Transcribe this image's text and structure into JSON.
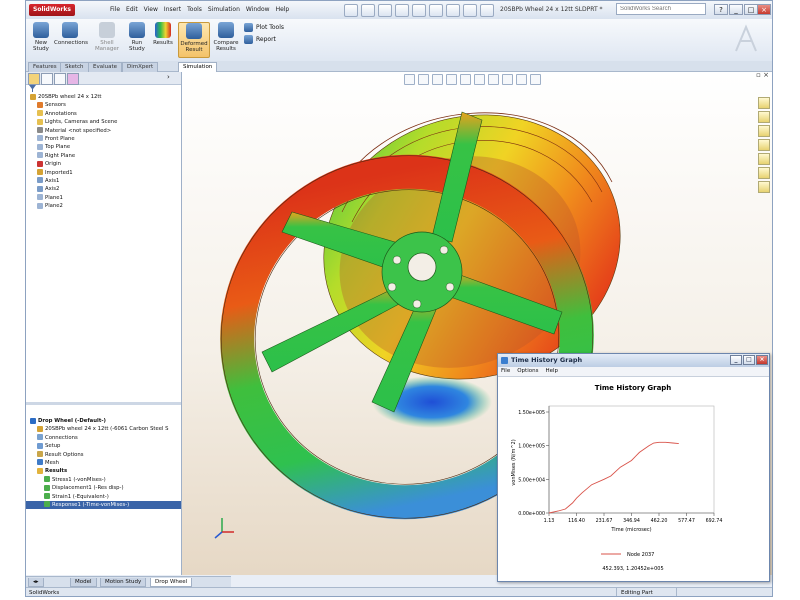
{
  "app": {
    "logo": "SolidWorks",
    "menu": [
      "File",
      "Edit",
      "View",
      "Insert",
      "Tools",
      "Simulation",
      "Window",
      "Help"
    ],
    "document_title": "20SBPb Wheel 24 x 12tt SLDPRT *",
    "search_placeholder": "SolidWorks Search",
    "window_buttons": [
      "?",
      "_",
      "□",
      "×"
    ]
  },
  "ribbon": {
    "buttons": [
      {
        "label": "New Study",
        "icon": "new-study-icon"
      },
      {
        "label": "Connections",
        "icon": "connections-icon"
      },
      {
        "label": "Shell Manager",
        "icon": "shell-icon"
      },
      {
        "label": "Run Study",
        "icon": "run-icon"
      },
      {
        "label": "Results",
        "icon": "results-icon"
      },
      {
        "label": "Deformed Result",
        "icon": "deformed-icon",
        "selected": true
      },
      {
        "label": "Compare Results",
        "icon": "compare-icon"
      }
    ],
    "plot_tools": "Plot Tools",
    "report": "Report"
  },
  "command_tabs": [
    "Features",
    "Sketch",
    "Evaluate",
    "DimXpert",
    "Simulation"
  ],
  "active_command_tab": "Simulation",
  "feature_tree": [
    {
      "label": "20SBPb wheel 24 x 12tt",
      "icon": "part-icon",
      "indent": 0
    },
    {
      "label": "Sensors",
      "icon": "sensor-icon",
      "indent": 1
    },
    {
      "label": "Annotations",
      "icon": "annotation-icon",
      "indent": 1
    },
    {
      "label": "Lights, Cameras and Scene",
      "icon": "lights-icon",
      "indent": 1
    },
    {
      "label": "Material <not specified>",
      "icon": "material-icon",
      "indent": 1
    },
    {
      "label": "Front Plane",
      "icon": "plane-icon",
      "indent": 1
    },
    {
      "label": "Top Plane",
      "icon": "plane-icon",
      "indent": 1
    },
    {
      "label": "Right Plane",
      "icon": "plane-icon",
      "indent": 1
    },
    {
      "label": "Origin",
      "icon": "origin-icon",
      "indent": 1
    },
    {
      "label": "Imported1",
      "icon": "imported-icon",
      "indent": 1
    },
    {
      "label": "Axis1",
      "icon": "axis-icon",
      "indent": 1
    },
    {
      "label": "Axis2",
      "icon": "axis-icon",
      "indent": 1
    },
    {
      "label": "Plane1",
      "icon": "plane-icon",
      "indent": 1
    },
    {
      "label": "Plane2",
      "icon": "plane-icon",
      "indent": 1
    }
  ],
  "sim_tree": [
    {
      "label": "Drop Wheel (-Default-)",
      "icon": "study-icon",
      "indent": 0,
      "bold": true
    },
    {
      "label": "20SBPb wheel 24 x 12tt (-6061 Carbon Steel S",
      "icon": "part-icon",
      "indent": 1
    },
    {
      "label": "Connections",
      "icon": "connections-icon",
      "indent": 1
    },
    {
      "label": "Setup",
      "icon": "setup-icon",
      "indent": 1
    },
    {
      "label": "Result Options",
      "icon": "options-icon",
      "indent": 1
    },
    {
      "label": "Mesh",
      "icon": "mesh-icon",
      "indent": 1
    },
    {
      "label": "Results",
      "icon": "results-folder-icon",
      "indent": 1,
      "bold": true
    },
    {
      "label": "Stress1 (-vonMises-)",
      "icon": "plot-icon",
      "indent": 2
    },
    {
      "label": "Displacement1 (-Res disp-)",
      "icon": "plot-icon",
      "indent": 2
    },
    {
      "label": "Strain1 (-Equivalent-)",
      "icon": "plot-icon",
      "indent": 2
    },
    {
      "label": "Response1 (-Time-vonMises-)",
      "icon": "plot-icon",
      "indent": 2,
      "selected": true
    }
  ],
  "bottom_tabs": [
    "Model",
    "Motion Study",
    "Drop Wheel"
  ],
  "active_bottom_tab": "Drop Wheel",
  "status": {
    "left": "SolidWorks",
    "editing": "Editing Part"
  },
  "graph_window": {
    "title": "Time History Graph",
    "menu": [
      "File",
      "Options",
      "Help"
    ],
    "buttons": [
      "_",
      "□",
      "×"
    ],
    "footer": "452.393, 1.20452e+005"
  },
  "chart_data": {
    "type": "line",
    "title": "Time History Graph",
    "xlabel": "Time (microsec)",
    "ylabel": "vonMises (N/m^2)",
    "x_ticks": [
      "1.13",
      "116.40",
      "231.67",
      "346.94",
      "462.20",
      "577.47",
      "692.74"
    ],
    "y_ticks": [
      "0.00e+000",
      "5.00e+004",
      "1.00e+005",
      "1.50e+005"
    ],
    "xlim": [
      1.13,
      692.74
    ],
    "ylim": [
      0,
      150000
    ],
    "grid": false,
    "legend": "bottom",
    "series": [
      {
        "name": "Node 2037",
        "color": "#d9534a",
        "x": [
          1.13,
          40,
          70,
          100,
          116.4,
          140,
          180,
          231.67,
          260,
          300,
          346.94,
          380,
          420,
          440,
          462.2,
          490,
          520,
          545
        ],
        "y": [
          0,
          3000,
          6000,
          15000,
          22000,
          30000,
          42000,
          50000,
          55000,
          68000,
          78000,
          90000,
          100000,
          104000,
          105000,
          105000,
          104000,
          103000
        ]
      }
    ]
  },
  "colors": {
    "accent": "#2f5f9c",
    "selected_ribbon": "#f4c36a",
    "series": "#d9534a"
  }
}
